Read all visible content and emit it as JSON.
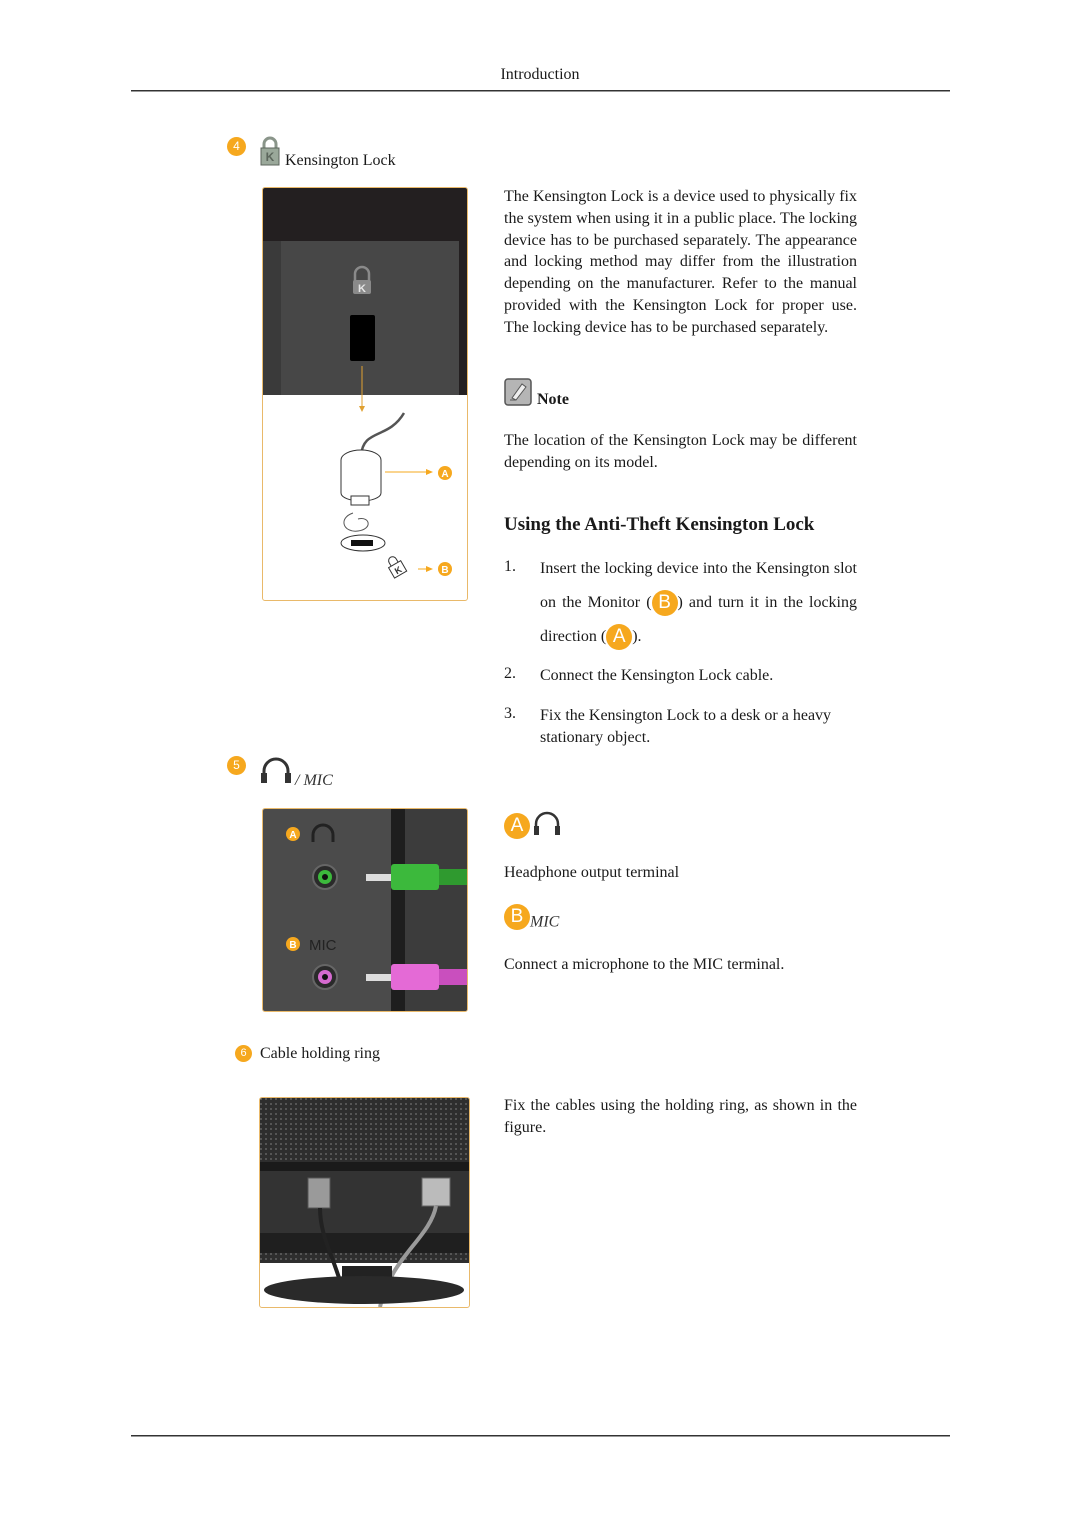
{
  "header": {
    "title": "Introduction"
  },
  "sections": {
    "kensington": {
      "number": "4",
      "icon": "kensington-lock-icon",
      "title": "Kensington Lock",
      "description": "The Kensington Lock is a device used to physically fix the system when using it in a public place. The locking device has to be purchased separately. The appearance and locking method may differ from the illustration depending on the manufacturer. Refer to the manual provided with the Kensington Lock for proper use. The locking device has to be purchased separately.",
      "figure": {
        "slot_label": "K",
        "callouts": [
          "A",
          "B"
        ]
      },
      "note": {
        "icon": "note-pencil-icon",
        "label": "Note",
        "text": "The location of the Kensington Lock may be different depending on its model."
      },
      "usage": {
        "heading": "Using the Anti-Theft Kensington Lock",
        "steps": [
          {
            "num": "1.",
            "text_a": "Insert the locking device into the Kensington slot on the Monitor (",
            "badge_1": "B",
            "text_b": ") and turn it in the locking direction (",
            "badge_2": "A",
            "text_c": ")."
          },
          {
            "num": "2.",
            "text": "Connect the Kensington Lock cable."
          },
          {
            "num": "3.",
            "text": "Fix the Kensington Lock to a desk or a heavy stationary object."
          }
        ]
      }
    },
    "audio": {
      "number": "5",
      "icon": "headphone-icon",
      "title": "/ MIC",
      "figure": {
        "label_a": "A",
        "label_b": "B",
        "mic_text": "MIC"
      },
      "items": [
        {
          "badge": "A",
          "icon": "headphone-icon",
          "desc": "Headphone output terminal"
        },
        {
          "badge": "B",
          "label": "MIC",
          "desc": "Connect a microphone to the MIC terminal."
        }
      ]
    },
    "cable_ring": {
      "number": "6",
      "title": "Cable holding ring",
      "description": "Fix the cables using the holding ring, as shown in the figure."
    }
  },
  "colors": {
    "accent": "#f6a81e",
    "figure_border": "#e9b96a",
    "headphone_jack": "#3cb93c",
    "mic_jack": "#e46ad6"
  }
}
